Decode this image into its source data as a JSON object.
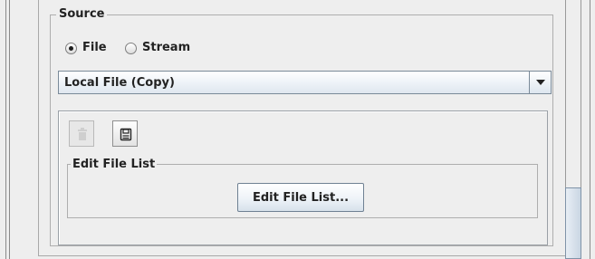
{
  "source": {
    "title": "Source",
    "radios": [
      {
        "label": "File",
        "selected": true
      },
      {
        "label": "Stream",
        "selected": false
      }
    ],
    "combo": {
      "value": "Local File (Copy)"
    },
    "toolbar": {
      "delete_icon": "trash-icon",
      "save_icon": "floppy-disk-icon"
    },
    "edit_group": {
      "title": "Edit File List",
      "button_label": "Edit File List..."
    }
  },
  "scrollbar": {
    "position": 0.72
  }
}
